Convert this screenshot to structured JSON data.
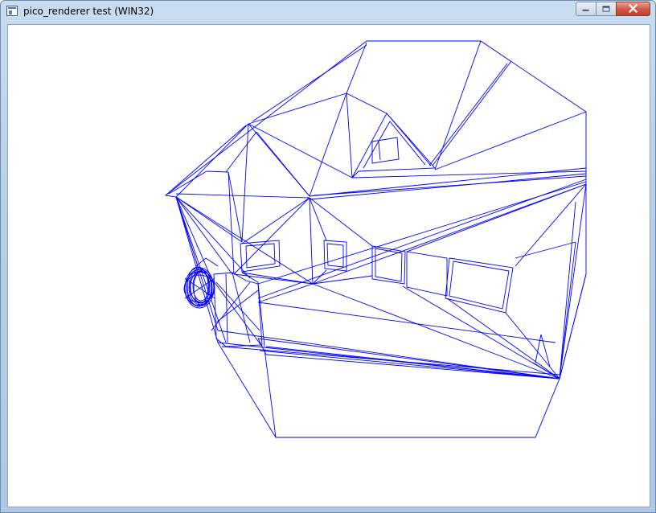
{
  "window": {
    "title": "pico_renderer test (WIN32)",
    "controls": [
      "minimize",
      "maximize",
      "close"
    ]
  },
  "icons": {
    "app": "app-window-icon",
    "minimize": "minimize-icon",
    "maximize": "maximize-icon",
    "close": "close-icon"
  },
  "colors": {
    "wireframe": "#0000ff",
    "background": "#ffffff",
    "close_button": "#c74a36"
  },
  "render": {
    "style": "wireframe",
    "subject": "3D house model"
  }
}
